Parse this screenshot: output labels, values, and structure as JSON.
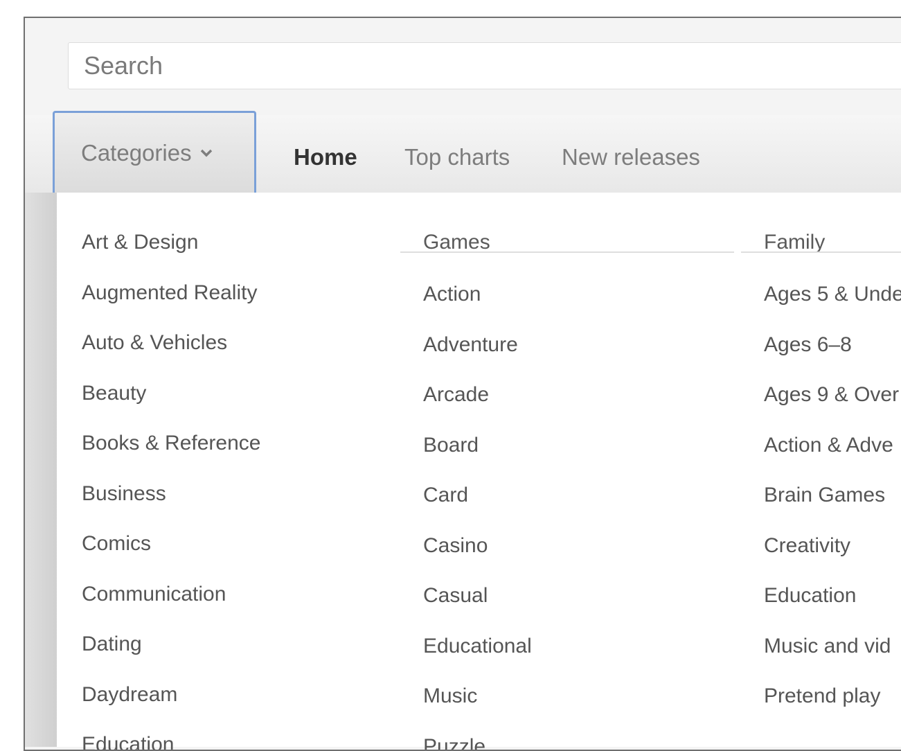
{
  "search": {
    "placeholder": "Search"
  },
  "nav": {
    "categories_label": "Categories",
    "tabs": [
      "Home",
      "Top charts",
      "New releases"
    ]
  },
  "categories": {
    "col1": [
      "Art & Design",
      "Augmented Reality",
      "Auto & Vehicles",
      "Beauty",
      "Books & Reference",
      "Business",
      "Comics",
      "Communication",
      "Dating",
      "Daydream",
      "Education"
    ],
    "col2": {
      "header": "Games",
      "items": [
        "Action",
        "Adventure",
        "Arcade",
        "Board",
        "Card",
        "Casino",
        "Casual",
        "Educational",
        "Music",
        "Puzzle"
      ]
    },
    "col3": {
      "header": "Family",
      "items": [
        "Ages 5 & Unde",
        "Ages 6–8",
        "Ages 9 & Over",
        "Action & Adve",
        "Brain Games",
        "Creativity",
        "Education",
        "Music and vid",
        "Pretend play"
      ]
    }
  },
  "colors": {
    "accent": "#7aa0d8",
    "active_tab": "#333333",
    "inactive_tab": "#7d7d7d"
  },
  "icons": {
    "categories_caret": "chevron-down-icon"
  }
}
